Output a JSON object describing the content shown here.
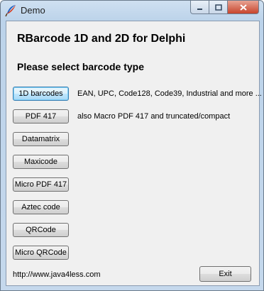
{
  "window": {
    "title": "Demo",
    "controls": {
      "minimize": "–",
      "maximize": "□",
      "close": "✕"
    }
  },
  "content": {
    "heading": "RBarcode 1D and 2D for Delphi",
    "subheading": "Please select barcode type",
    "buttons": [
      "1D barcodes",
      "PDF 417",
      "Datamatrix",
      "Maxicode",
      "Micro PDF 417",
      "Aztec code",
      "QRCode",
      "Micro QRCode"
    ],
    "descriptions": {
      "1d": "EAN, UPC, Code128, Code39, Industrial and more ...",
      "pdf417": "also Macro PDF 417 and truncated/compact"
    },
    "url": "http://www.java4less.com",
    "exit_label": "Exit"
  },
  "colors": {
    "title_bar": "#bcd3ea",
    "close_button": "#c7442c",
    "client_bg": "#f0f0f0",
    "focus_border": "#3c7fb1"
  },
  "icons": {
    "app": "feather-icon",
    "minimize": "minimize-icon",
    "maximize": "maximize-icon",
    "close": "close-icon"
  }
}
